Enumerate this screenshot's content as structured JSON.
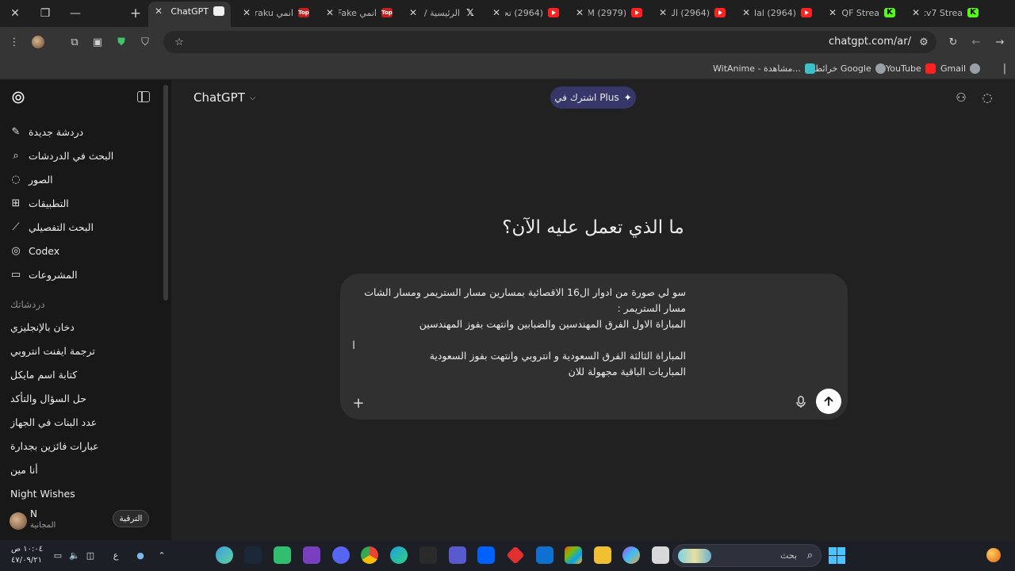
{
  "browser": {
    "tabs": [
      {
        "title": "ChatGPT",
        "favicon": "chatgpt-icon",
        "active": true
      },
      {
        "title": "انمي Buraku",
        "favicon": "top-icon"
      },
      {
        "title": "انمي Fake",
        "favicon": "top-icon"
      },
      {
        "title": "الرئيسية / X",
        "favicon": "x-icon"
      },
      {
        "title": "(2964) تحد",
        "favicon": "youtube-icon"
      },
      {
        "title": "(2979) Ya M",
        "favicon": "youtube-icon"
      },
      {
        "title": "(2964) البد",
        "favicon": "youtube-icon"
      },
      {
        "title": "(2964) Mal",
        "favicon": "youtube-icon"
      },
      {
        "title": "viiQF Strea",
        "favicon": "kick-icon"
      },
      {
        "title": "Nxv7 Strea",
        "favicon": "kick-icon"
      }
    ],
    "url": "chatgpt.com/ar/",
    "bookmarks": [
      {
        "label": "Gmail",
        "icon": "gmail-icon"
      },
      {
        "label": "YouTube",
        "icon": "youtube-icon"
      },
      {
        "label": "خرائط Google",
        "icon": "maps-icon"
      },
      {
        "label": "WitAnime - مشاهدة...",
        "icon": "witanime-icon"
      }
    ]
  },
  "sidebar": {
    "nav": [
      {
        "label": "دردشة جديدة",
        "icon": "edit-icon"
      },
      {
        "label": "البحث في الدردشات",
        "icon": "search-icon"
      },
      {
        "label": "الصور",
        "icon": "image-icon"
      },
      {
        "label": "التطبيقات",
        "icon": "apps-icon"
      },
      {
        "label": "البحث التفصيلي",
        "icon": "telescope-icon"
      },
      {
        "label": "Codex",
        "icon": "codex-icon"
      },
      {
        "label": "المشروعات",
        "icon": "folder-icon"
      }
    ],
    "section_title": "دردشاتك",
    "chats": [
      "دخان بالإنجليزي",
      "ترجمة ايفنت انتروبي",
      "كتابة اسم مايكل",
      "حل السؤال والتأكد",
      "عدد البنات في الجهاز",
      "عبارات فائزين بجدارة",
      "أنا مين",
      "Night Wishes"
    ],
    "user": {
      "name": "N",
      "plan": "المجانية"
    },
    "upgrade_label": "الترقية"
  },
  "main": {
    "model": "ChatGPT",
    "plus_label": "اشترك في Plus",
    "headline": "ما الذي تعمل عليه الآن؟",
    "composer_lines": [
      "سو لي صورة من ادوار ال16 الاقصائية بمسارين مسار الستريمر ومسار الشات",
      "مسار الستريمر :",
      "المباراة الاول الفرق المهندسين والضبابين وانتهت بفوز المهندسين",
      "",
      "المباراة الثالثة الفرق السعودية و انتروبي وانتهت بفوز السعودية",
      "المباريات الباقية مجهولة للان"
    ]
  },
  "taskbar": {
    "time": "١٠:٠٤ ص",
    "date": "٤٧/٠٩/٢١",
    "lang": "ع",
    "search_label": "بحث"
  }
}
